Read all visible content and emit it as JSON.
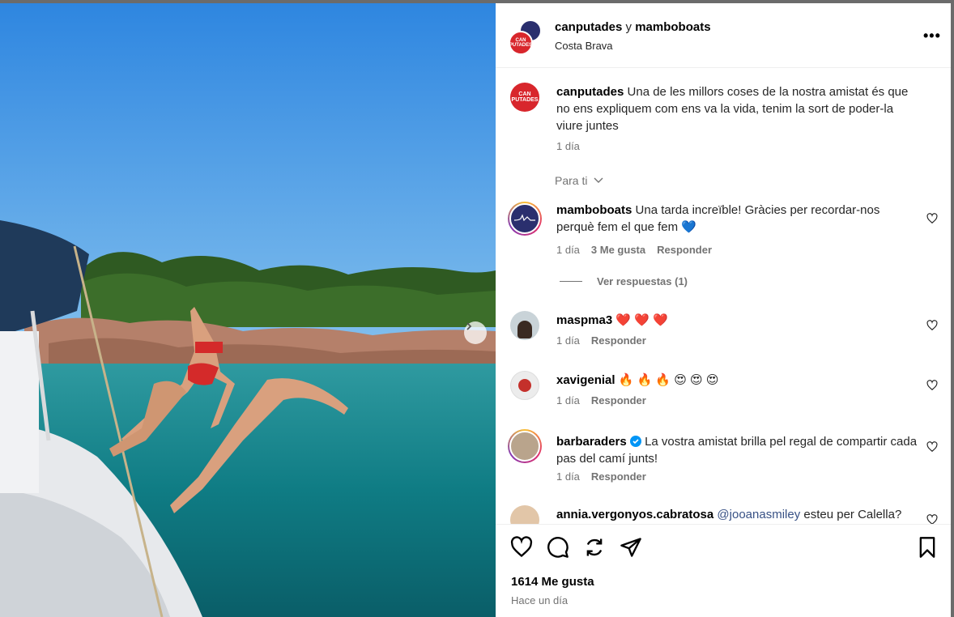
{
  "post": {
    "author_primary": "canputades",
    "connector": "y",
    "author_secondary": "mamboboats",
    "location": "Costa Brava",
    "avatar_text": "CAN PUTADES"
  },
  "caption": {
    "user": "canputades",
    "text": "Una de les millors coses de la nostra amistat és que no ens expliquem com ens va la vida, tenim la sort de poder-la viure juntes",
    "time": "1 día"
  },
  "filter_label": "Para ti",
  "comments": [
    {
      "user": "mamboboats",
      "text": "Una tarda increïble! Gràcies per recordar-nos perquè fem el que fem 💙",
      "time": "1 día",
      "likes": "3 Me gusta",
      "reply": "Responder"
    },
    {
      "user": "maspma3",
      "text": "❤️ ❤️ ❤️",
      "time": "1 día",
      "reply": "Responder"
    },
    {
      "user": "xavigenial",
      "text": "🔥 🔥 🔥 😍 😍 😍",
      "time": "1 día",
      "reply": "Responder"
    },
    {
      "user": "barbaraders",
      "text": "La vostra amistat brilla pel regal de compartir cada pas del camí junts!",
      "time": "1 día",
      "reply": "Responder"
    },
    {
      "user": "annia.vergonyos.cabratosa",
      "mention": "@jooanasmiley",
      "text": "esteu per Calella?"
    }
  ],
  "view_replies": "Ver respuestas (1)",
  "likes_count": "1614 Me gusta",
  "posted_ago": "Hace un día",
  "icons": [
    "more-icon",
    "heart-icon",
    "comment-icon",
    "share-icon",
    "send-icon",
    "bookmark-icon",
    "chevron-right-icon",
    "chevron-down-icon",
    "verified-icon"
  ],
  "colors": {
    "muted": "#737373",
    "link": "#385185",
    "verified": "#0095f6",
    "brand_red": "#d8262c",
    "brand_navy": "#2a2f6e"
  }
}
